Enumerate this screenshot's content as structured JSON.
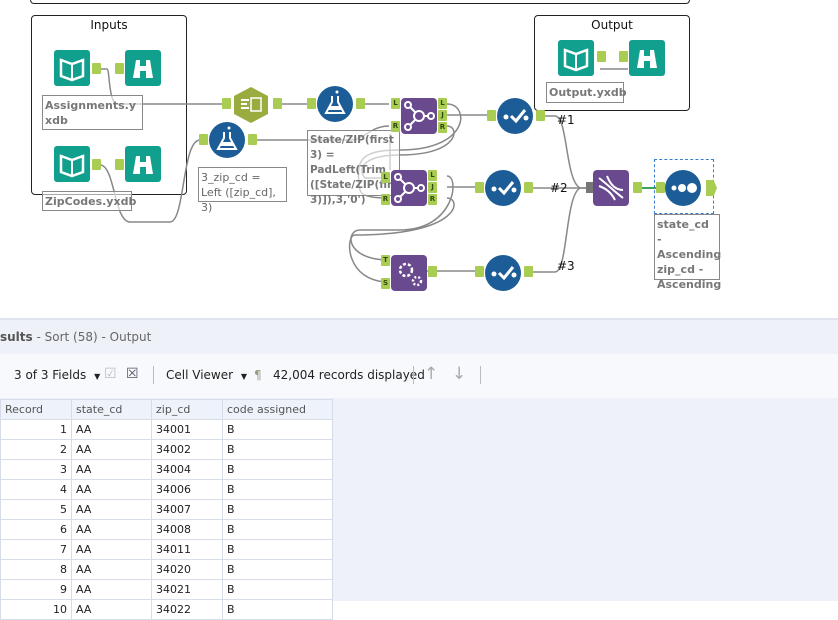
{
  "canvas": {
    "containers": [
      {
        "title": "Inputs"
      },
      {
        "title": "Output"
      }
    ],
    "annotations": {
      "assignments": "Assignments.yxdb",
      "zipcodes": "ZipCodes.yxdb",
      "formula1": "3_zip_cd = Left ([zip_cd], 3)",
      "formula2": "State/ZIP(first 3) = PadLeft(Trim ([State/ZIP(first 3)]),3,'0')",
      "output": "Output.yxdb",
      "sort": "state_cd - Ascending zip_cd - Ascending"
    },
    "connection_labels": [
      "#1",
      "#2",
      "#3"
    ],
    "ports": {
      "left": "L",
      "right": "R",
      "join": "J",
      "target": "T",
      "source": "S"
    },
    "colors": {
      "input_output": "#12a08e",
      "join": "#6a4a8f",
      "formula": "#1c5d97",
      "summarize": "#9aab3f",
      "port": "#a9cc52"
    }
  },
  "results": {
    "title_prefix": "sults",
    "title_rest": " - Sort (58) - Output",
    "toolbar": {
      "fields": "3 of 3 Fields",
      "viewer": "Cell Viewer",
      "records": "42,004 records displayed"
    },
    "columns": [
      "Record",
      "state_cd",
      "zip_cd",
      "code assigned"
    ],
    "rows": [
      [
        "1",
        "AA",
        "34001",
        "B"
      ],
      [
        "2",
        "AA",
        "34002",
        "B"
      ],
      [
        "3",
        "AA",
        "34004",
        "B"
      ],
      [
        "4",
        "AA",
        "34006",
        "B"
      ],
      [
        "5",
        "AA",
        "34007",
        "B"
      ],
      [
        "6",
        "AA",
        "34008",
        "B"
      ],
      [
        "7",
        "AA",
        "34011",
        "B"
      ],
      [
        "8",
        "AA",
        "34020",
        "B"
      ],
      [
        "9",
        "AA",
        "34021",
        "B"
      ],
      [
        "10",
        "AA",
        "34022",
        "B"
      ]
    ]
  }
}
